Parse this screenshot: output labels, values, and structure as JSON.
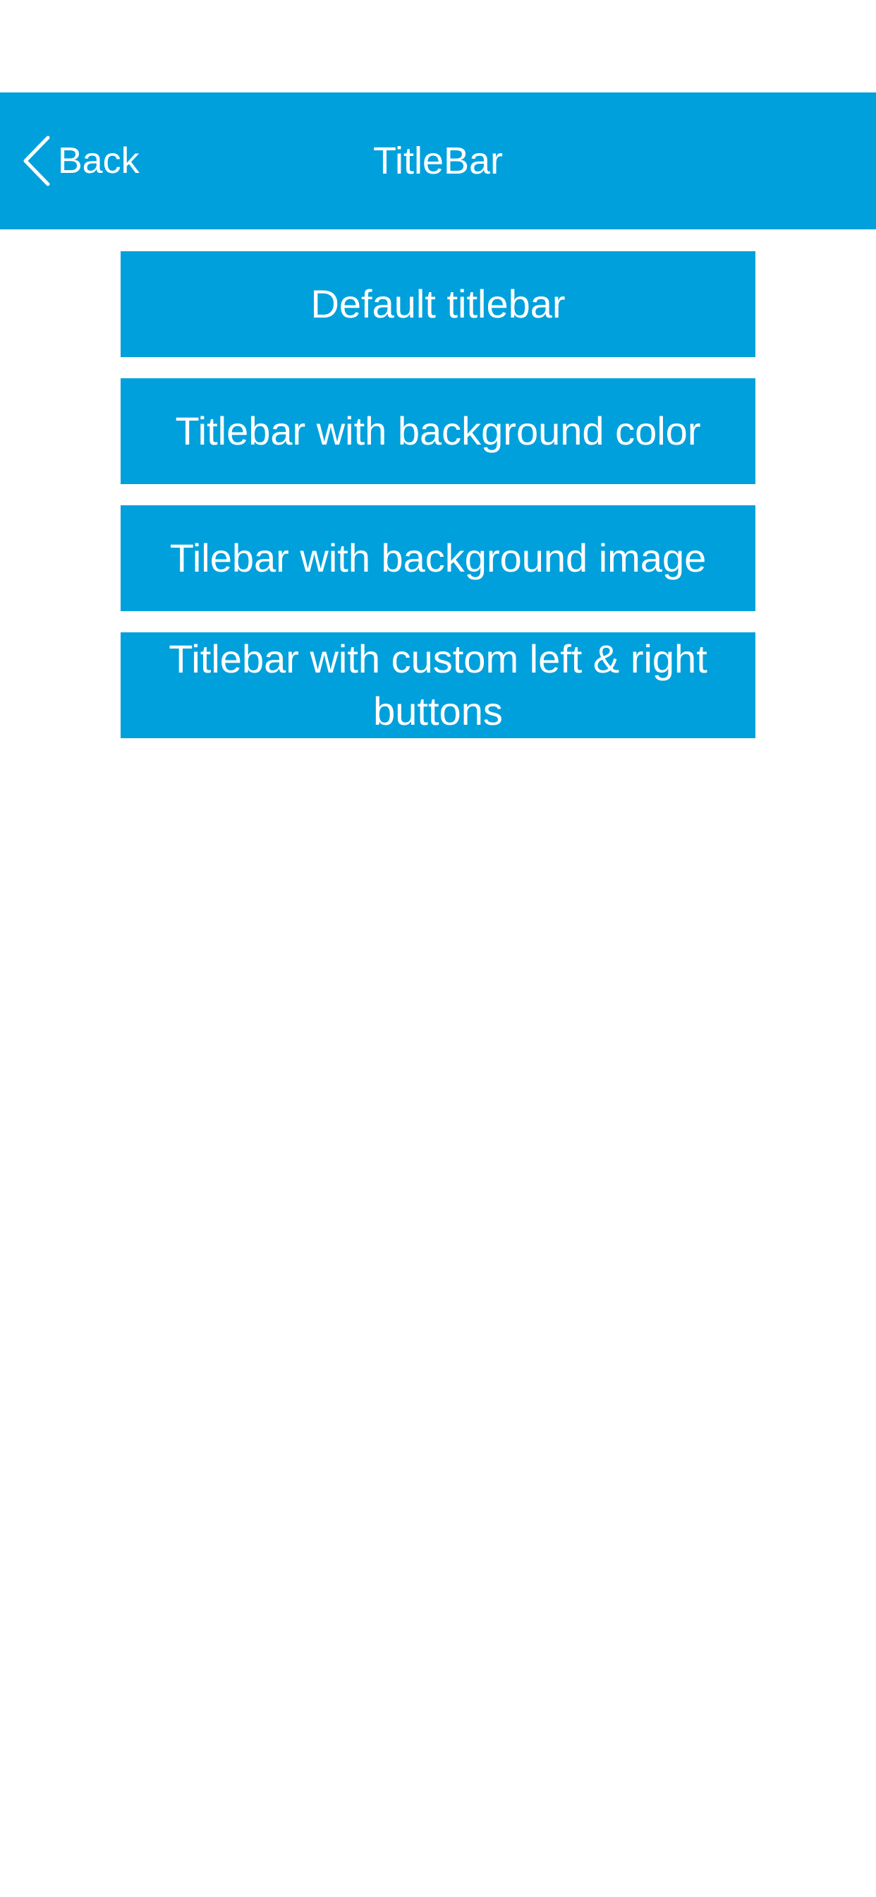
{
  "nav": {
    "back_label": "Back",
    "title": "TitleBar",
    "back_icon": "chevron-left-icon"
  },
  "menu": {
    "items": [
      {
        "label": "Default titlebar"
      },
      {
        "label": "Titlebar with background color"
      },
      {
        "label": "Tilebar with background image"
      },
      {
        "label": "Titlebar with custom left & right buttons"
      }
    ]
  },
  "colors": {
    "accent": "#00a0dc",
    "text_on_accent": "#ffffff",
    "background": "#ffffff"
  }
}
